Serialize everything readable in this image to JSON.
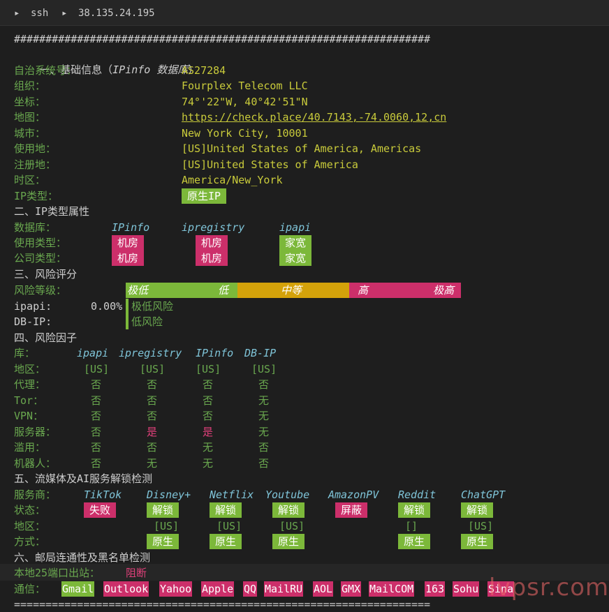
{
  "titlebar": {
    "arrow": "▸",
    "ssh": "ssh",
    "host": "38.135.24.195"
  },
  "separator_top": "##################################################################",
  "separator_bottom": "==================================================================",
  "s1": {
    "title_prefix": "一、基础信息（",
    "title_db": "IPinfo 数据库",
    "title_suffix": "）",
    "rows": [
      {
        "label": "自治系统号：",
        "value": "AS27284"
      },
      {
        "label": "组织：",
        "value": "Fourplex Telecom LLC"
      },
      {
        "label": "坐标：",
        "value": "74°'22\"W, 40°42'51\"N"
      },
      {
        "label": "地图：",
        "value": "https://check.place/40.7143,-74.0060,12,cn"
      },
      {
        "label": "城市：",
        "value": "New York City, 10001"
      },
      {
        "label": "使用地：",
        "value": "[US]United States of America, Americas"
      },
      {
        "label": "注册地：",
        "value": "[US]United States of America"
      },
      {
        "label": "时区：",
        "value": "America/New_York"
      },
      {
        "label": "IP类型：",
        "value": "原生IP"
      }
    ]
  },
  "s2": {
    "title": "二、IP类型属性",
    "db_label": "数据库：",
    "dbs": [
      "IPinfo",
      "ipregistry",
      "ipapi"
    ],
    "usage_label": "使用类型：",
    "usage": [
      "机房",
      "机房",
      "家宽"
    ],
    "company_label": "公司类型：",
    "company": [
      "机房",
      "机房",
      "家宽"
    ]
  },
  "s3": {
    "title": "三、风险评分",
    "level_label": "风险等级：",
    "levels": {
      "very_low": "极低",
      "low": "低",
      "mid": "中等",
      "high": "高",
      "very_high": "极高"
    },
    "ipapi_label": "ipapi:",
    "ipapi_value": "0.00%",
    "ipapi_text": "极低风险",
    "dbip_label": "DB-IP:",
    "dbip_text": "低风险",
    "colors": {
      "low": "#7cb83a",
      "mid": "#d4a20a",
      "high": "#cc2f6a"
    }
  },
  "s4": {
    "title": "四、风险因子",
    "db_label": "库：",
    "cols": [
      "ipapi",
      "ipregistry",
      "IPinfo",
      "DB-IP"
    ],
    "rows": [
      {
        "label": "地区：",
        "vals": [
          "[US]",
          "[US]",
          "[US]",
          "[US]"
        ]
      },
      {
        "label": "代理：",
        "vals": [
          "否",
          "否",
          "否",
          "否"
        ]
      },
      {
        "label": "Tor：",
        "vals": [
          "否",
          "否",
          "否",
          "无"
        ]
      },
      {
        "label": "VPN：",
        "vals": [
          "否",
          "否",
          "否",
          "无"
        ]
      },
      {
        "label": "服务器：",
        "vals": [
          "否",
          "是",
          "是",
          "无"
        ]
      },
      {
        "label": "滥用：",
        "vals": [
          "否",
          "否",
          "无",
          "否"
        ]
      },
      {
        "label": "机器人：",
        "vals": [
          "否",
          "无",
          "无",
          "否"
        ]
      }
    ]
  },
  "s5": {
    "title": "五、流媒体及AI服务解锁检测",
    "svc_label": "服务商：",
    "services": [
      "TikTok",
      "Disney+",
      "Netflix",
      "Youtube",
      "AmazonPV",
      "Reddit",
      "ChatGPT"
    ],
    "status_label": "状态：",
    "status": [
      "失败",
      "解锁",
      "解锁",
      "解锁",
      "屏蔽",
      "解锁",
      "解锁"
    ],
    "region_label": "地区：",
    "region": [
      "",
      "[US]",
      "[US]",
      "[US]",
      "",
      "[]",
      "[US]"
    ],
    "mode_label": "方式：",
    "mode": [
      "",
      "原生",
      "原生",
      "原生",
      "",
      "原生",
      "原生"
    ]
  },
  "s6": {
    "title": "六、邮局连通性及黑名单检测",
    "port_label": "本地25端口出站：",
    "port_value": "阻断",
    "comm_label": "通信：",
    "providers": [
      "Gmail",
      "Outlook",
      "Yahoo",
      "Apple",
      "QQ",
      "MailRU",
      "AOL",
      "GMX",
      "MailCOM",
      "163",
      "Sohu",
      "Sina"
    ]
  },
  "watermark": "lvpsr.com"
}
